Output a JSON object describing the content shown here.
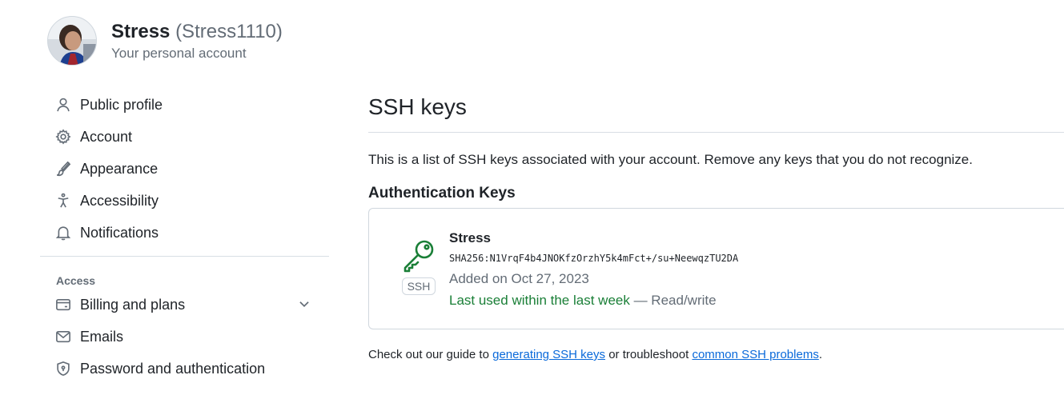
{
  "user": {
    "name": "Stress",
    "login": "(Stress1110)",
    "subtitle": "Your personal account",
    "avatar_icon": "user-avatar-photo"
  },
  "sidebar": {
    "items": [
      {
        "label": "Public profile",
        "icon": "person-icon"
      },
      {
        "label": "Account",
        "icon": "gear-icon"
      },
      {
        "label": "Appearance",
        "icon": "paintbrush-icon"
      },
      {
        "label": "Accessibility",
        "icon": "accessibility-icon"
      },
      {
        "label": "Notifications",
        "icon": "bell-icon"
      }
    ],
    "access_group": "Access",
    "access_items": [
      {
        "label": "Billing and plans",
        "icon": "credit-card-icon",
        "expandable": true
      },
      {
        "label": "Emails",
        "icon": "mail-icon"
      },
      {
        "label": "Password and authentication",
        "icon": "shield-lock-icon"
      }
    ]
  },
  "main": {
    "title": "SSH keys",
    "intro": "This is a list of SSH keys associated with your account. Remove any keys that you do not recognize.",
    "section_title": "Authentication Keys",
    "key": {
      "title": "Stress",
      "fingerprint": "SHA256:N1VrqF4b4JNOKfzOrzhY5k4mFct+/su+NeewqzTU2DA",
      "added": "Added on Oct 27, 2023",
      "last_used": "Last used within the last week",
      "access": " — Read/write",
      "type_badge": "SSH",
      "icon": "key-icon"
    },
    "guide": {
      "prefix": "Check out our guide to ",
      "link1": "generating SSH keys",
      "middle": " or troubleshoot ",
      "link2": "common SSH problems",
      "suffix": "."
    }
  },
  "colors": {
    "accent_green": "#1a7f37",
    "link_blue": "#0969da",
    "muted": "#636c76",
    "border": "#d0d7de"
  }
}
